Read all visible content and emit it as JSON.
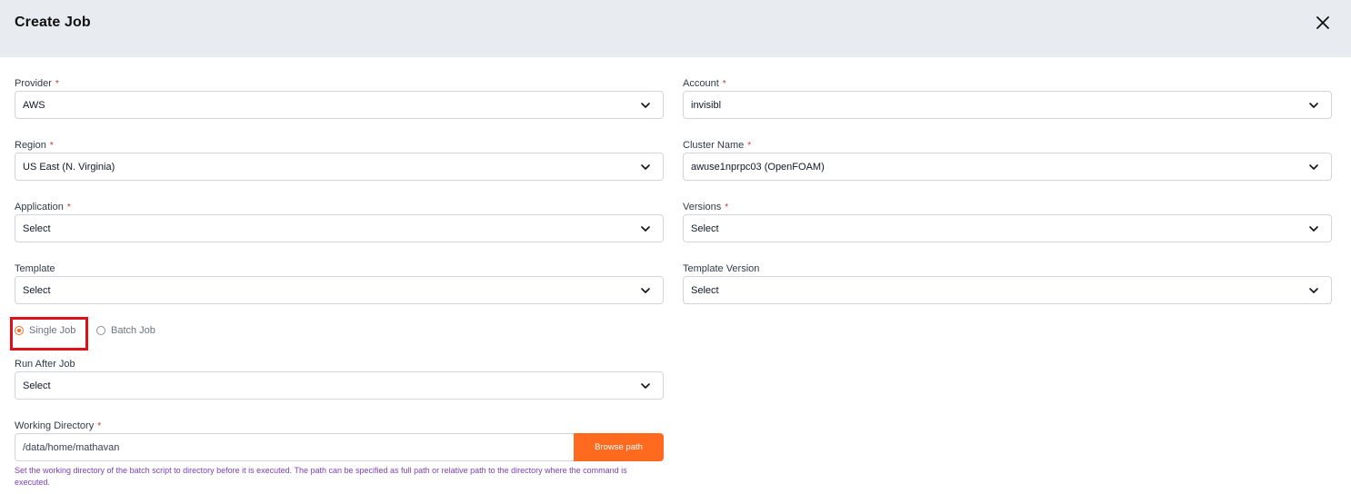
{
  "modal": {
    "title": "Create Job"
  },
  "fields": {
    "provider": {
      "label": "Provider",
      "required": true,
      "value": "AWS"
    },
    "account": {
      "label": "Account",
      "required": true,
      "value": "invisibl"
    },
    "region": {
      "label": "Region",
      "required": true,
      "value": "US East (N. Virginia)"
    },
    "cluster": {
      "label": "Cluster Name",
      "required": true,
      "value": "awuse1nprpc03 (OpenFOAM)"
    },
    "application": {
      "label": "Application",
      "required": true,
      "value": "Select"
    },
    "versions": {
      "label": "Versions",
      "required": true,
      "value": "Select"
    },
    "template": {
      "label": "Template",
      "required": false,
      "value": "Select"
    },
    "template_version": {
      "label": "Template Version",
      "required": false,
      "value": "Select"
    },
    "run_after_job": {
      "label": "Run After Job",
      "required": false,
      "value": "Select"
    },
    "working_directory": {
      "label": "Working Directory",
      "required": true,
      "value": "/data/home/mathavan",
      "browse_label": "Browse path",
      "help": "Set the working directory of the batch script to directory before it is executed. The path can be specified as full path or relative path to the directory where the command is executed."
    }
  },
  "job_type": {
    "options": [
      {
        "label": "Single Job",
        "selected": true
      },
      {
        "label": "Batch Job",
        "selected": false
      }
    ]
  },
  "required_marker": "*",
  "colors": {
    "accent": "#ff6a1f",
    "header_bg": "#e8ebef",
    "required": "#c0392b",
    "help_text": "#7b3fb8",
    "highlight": "#e0101a"
  },
  "icons": {
    "close": "close-icon",
    "dropdown": "chevron-down-icon"
  }
}
